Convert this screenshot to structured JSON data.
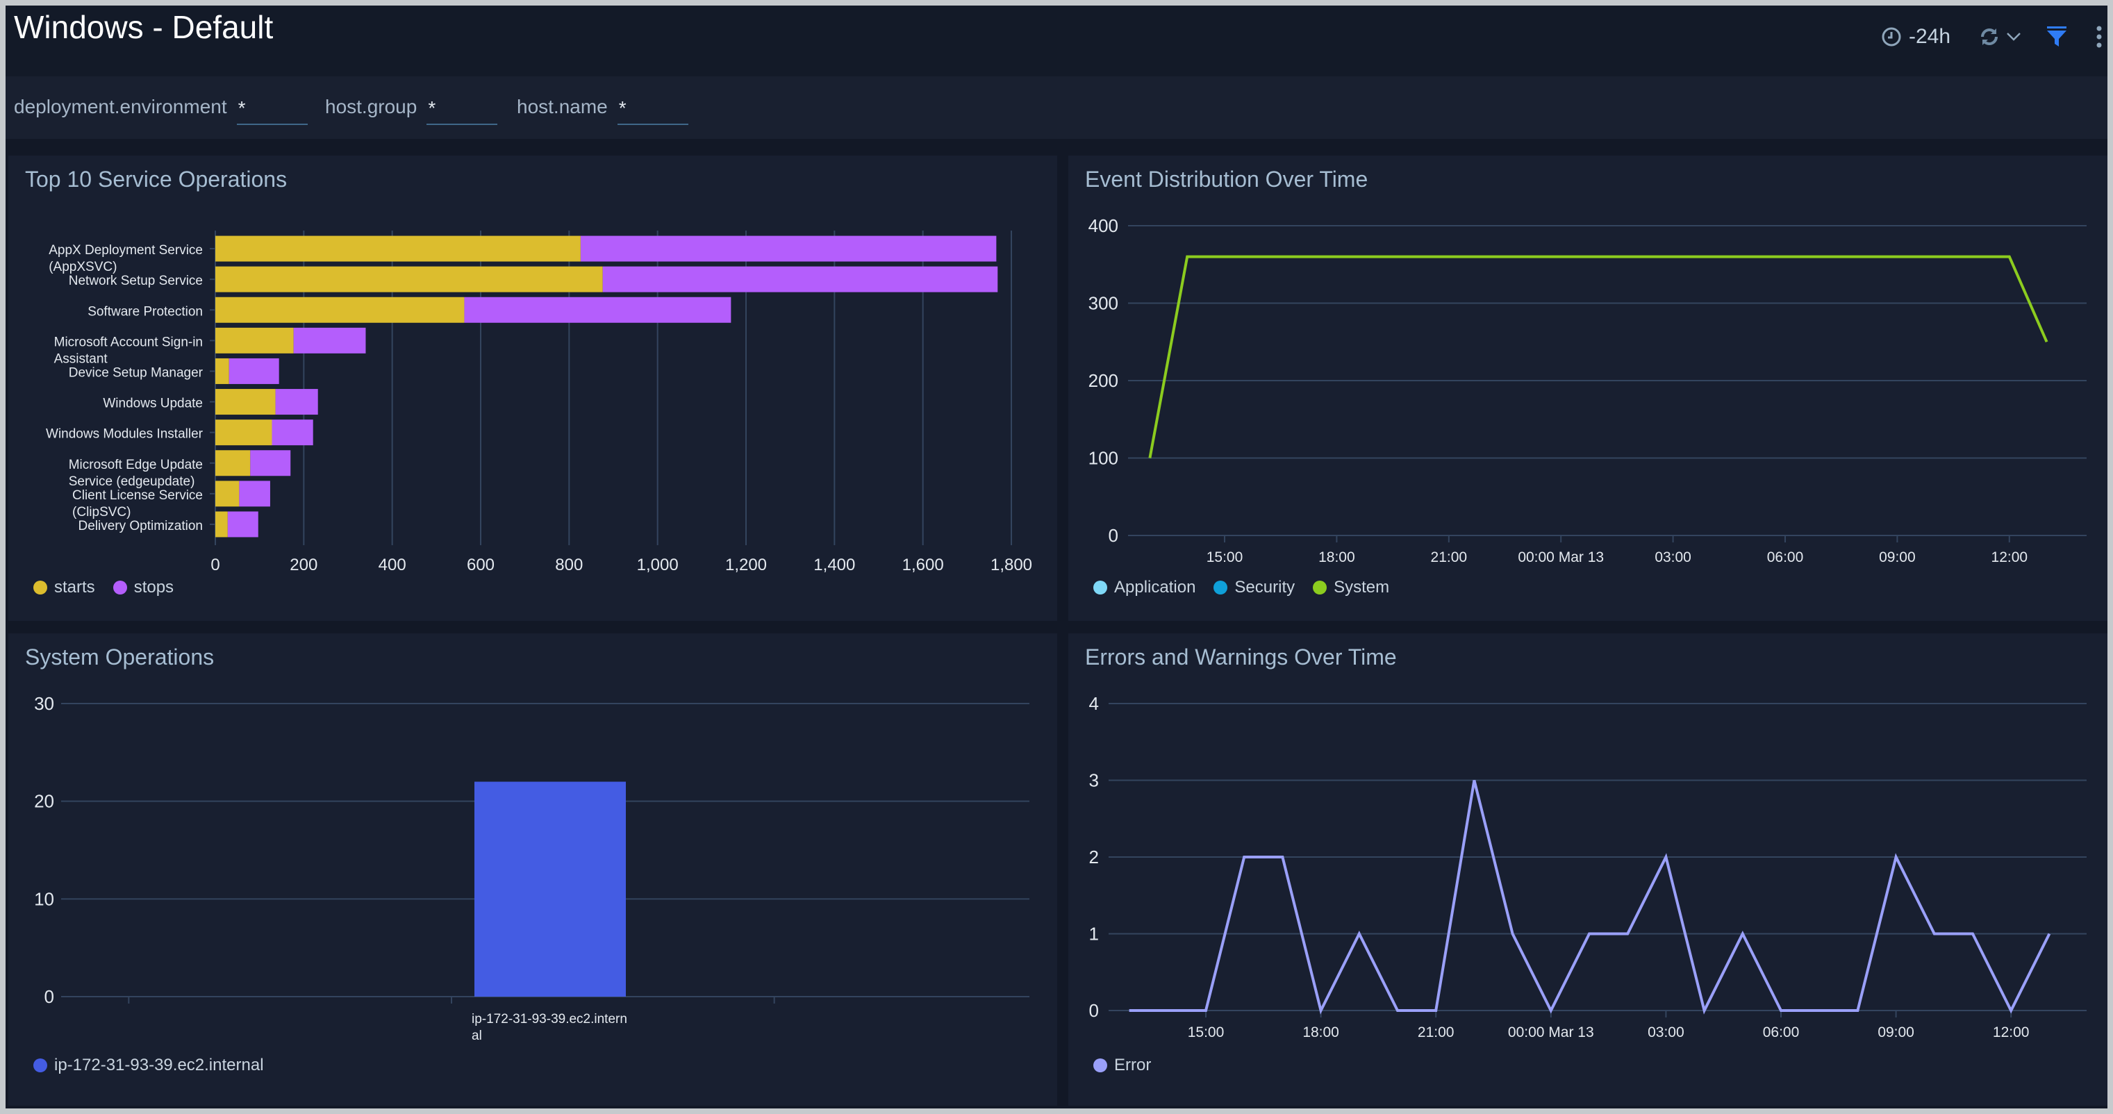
{
  "header": {
    "title": "Windows - Default",
    "time_range": "-24h",
    "icons": {
      "clock": "clock-icon",
      "refresh": "refresh-icon",
      "chevron": "chevron-down-icon",
      "filter": "filter-icon",
      "more": "more-vertical-icon"
    },
    "filter_color": "#2f7cf6"
  },
  "filters": [
    {
      "label": "deployment.environment",
      "value": "*"
    },
    {
      "label": "host.group",
      "value": "*"
    },
    {
      "label": "host.name",
      "value": "*"
    }
  ],
  "panels": {
    "service_ops": {
      "title": "Top 10 Service Operations"
    },
    "event_dist": {
      "title": "Event Distribution Over Time"
    },
    "system_ops": {
      "title": "System Operations"
    },
    "errors": {
      "title": "Errors and Warnings Over Time"
    }
  },
  "chart_data": [
    {
      "id": "service_ops",
      "type": "bar",
      "orientation": "horizontal",
      "stacked": true,
      "title": "Top 10 Service Operations",
      "categories": [
        "AppX Deployment Service (AppXSVC)",
        "Network Setup Service",
        "Software Protection",
        "Microsoft Account Sign-in Assistant",
        "Device Setup Manager",
        "Windows Update",
        "Windows Modules Installer",
        "Microsoft Edge Update Service (edgeupdate)",
        "Client License Service (ClipSVC)",
        "Delivery Optimization"
      ],
      "category_lines": [
        [
          "AppX Deployment Service",
          "(AppXSVC)"
        ],
        [
          "Network Setup Service"
        ],
        [
          "Software Protection"
        ],
        [
          "Microsoft Account Sign-in",
          "Assistant"
        ],
        [
          "Device Setup Manager"
        ],
        [
          "Windows Update"
        ],
        [
          "Windows Modules Installer"
        ],
        [
          "Microsoft Edge Update",
          "Service (edgeupdate)"
        ],
        [
          "Client License Service",
          "(ClipSVC)"
        ],
        [
          "Delivery Optimization"
        ]
      ],
      "series": [
        {
          "name": "starts",
          "color": "#dcbd2e",
          "values": [
            826,
            876,
            563,
            177,
            31,
            136,
            128,
            79,
            54,
            28
          ]
        },
        {
          "name": "stops",
          "color": "#b45efc",
          "values": [
            940,
            893,
            603,
            163,
            113,
            96,
            93,
            91,
            70,
            69
          ]
        }
      ],
      "xlim": [
        0,
        1800
      ],
      "xticks": [
        0,
        200,
        400,
        600,
        800,
        1000,
        1200,
        1400,
        1600,
        1800
      ],
      "xtick_labels": [
        "0",
        "200",
        "400",
        "600",
        "800",
        "1,000",
        "1,200",
        "1,400",
        "1,600",
        "1,800"
      ],
      "grid": true,
      "legend": "bottom-left"
    },
    {
      "id": "event_dist",
      "type": "line",
      "title": "Event Distribution Over Time",
      "x_hours": [
        13,
        14,
        15,
        16,
        17,
        18,
        19,
        20,
        21,
        22,
        23,
        24,
        25,
        26,
        27,
        28,
        29,
        30,
        31,
        32,
        33,
        34,
        35,
        36,
        37
      ],
      "series": [
        {
          "name": "Application",
          "color": "#7fd8f7",
          "values": []
        },
        {
          "name": "Security",
          "color": "#0fa0d9",
          "values": []
        },
        {
          "name": "System",
          "color": "#8ccc1f",
          "values": [
            100,
            360,
            360,
            360,
            360,
            360,
            360,
            360,
            360,
            360,
            360,
            360,
            360,
            360,
            360,
            360,
            360,
            360,
            360,
            360,
            360,
            360,
            360,
            360,
            250
          ]
        }
      ],
      "ylim": [
        0,
        400
      ],
      "yticks": [
        0,
        100,
        200,
        300,
        400
      ],
      "xticks_hours": [
        15,
        18,
        21,
        24,
        27,
        30,
        33,
        36
      ],
      "xtick_labels": [
        "15:00",
        "18:00",
        "21:00",
        "00:00 Mar 13",
        "03:00",
        "06:00",
        "09:00",
        "12:00"
      ],
      "grid": true,
      "legend": "bottom-left"
    },
    {
      "id": "system_ops",
      "type": "bar",
      "title": "System Operations",
      "categories": [
        "ip-172-31-93-39.ec2.internal"
      ],
      "category_lines": [
        [
          "ip-172-31-93-39.ec2.intern",
          "al"
        ]
      ],
      "series": [
        {
          "name": "ip-172-31-93-39.ec2.internal",
          "color": "#445ce3",
          "values": [
            22
          ]
        }
      ],
      "ylim": [
        0,
        30
      ],
      "yticks": [
        0,
        10,
        20,
        30
      ],
      "grid": true,
      "legend": "bottom-left"
    },
    {
      "id": "errors",
      "type": "line",
      "title": "Errors and Warnings Over Time",
      "x_hours": [
        13,
        14,
        15,
        16,
        17,
        18,
        19,
        20,
        21,
        22,
        23,
        24,
        25,
        26,
        27,
        28,
        29,
        30,
        31,
        32,
        33,
        34,
        35,
        36,
        37
      ],
      "series": [
        {
          "name": "Error",
          "color": "#9aa0f9",
          "values": [
            0,
            0,
            0,
            2,
            2,
            0,
            1,
            0,
            0,
            3,
            1,
            0,
            1,
            1,
            2,
            0,
            1,
            0,
            0,
            0,
            2,
            1,
            1,
            0,
            1
          ]
        }
      ],
      "ylim": [
        0,
        4
      ],
      "yticks": [
        0,
        1,
        2,
        3,
        4
      ],
      "xticks_hours": [
        15,
        18,
        21,
        24,
        27,
        30,
        33,
        36
      ],
      "xtick_labels": [
        "15:00",
        "18:00",
        "21:00",
        "00:00 Mar 13",
        "03:00",
        "06:00",
        "09:00",
        "12:00"
      ],
      "grid": true,
      "legend": "bottom-left"
    }
  ]
}
